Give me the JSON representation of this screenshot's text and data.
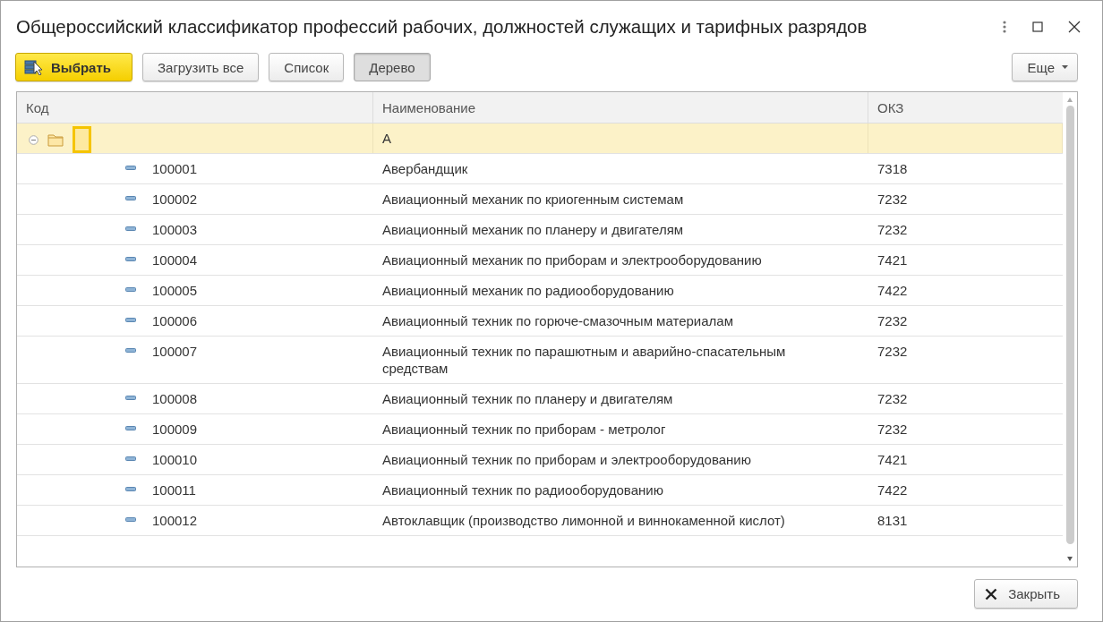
{
  "window": {
    "title": "Общероссийский классификатор профессий рабочих, должностей служащих и тарифных разрядов"
  },
  "toolbar": {
    "buttons": [
      {
        "label": "Выбрать",
        "kind": "primary"
      },
      {
        "label": "Загрузить все",
        "kind": "plain"
      },
      {
        "label": "Список",
        "kind": "toggle",
        "selected": false
      },
      {
        "label": "Дерево",
        "kind": "toggle",
        "selected": true
      }
    ],
    "more": "Еще"
  },
  "table": {
    "columns": [
      "Код",
      "Наименование",
      "ОКЗ"
    ],
    "rows": [
      {
        "kind": "group",
        "code": "",
        "name": "А",
        "okz": "",
        "expanded": true,
        "selected": true,
        "children": [
          {
            "kind": "item",
            "code": "100001",
            "name": "Авербандщик",
            "okz": "7318",
            "selected": false
          },
          {
            "kind": "item",
            "code": "100002",
            "name": "Авиационный механик по криогенным системам",
            "okz": "7232",
            "selected": false
          },
          {
            "kind": "item",
            "code": "100003",
            "name": "Авиационный механик по планеру и двигателям",
            "okz": "7232",
            "selected": false
          },
          {
            "kind": "item",
            "code": "100004",
            "name": "Авиационный механик по приборам и электрооборудованию",
            "okz": "7421",
            "selected": false
          },
          {
            "kind": "item",
            "code": "100005",
            "name": "Авиационный механик по радиооборудованию",
            "okz": "7422",
            "selected": false
          },
          {
            "kind": "item",
            "code": "100006",
            "name": "Авиационный техник по горюче-смазочным материалам",
            "okz": "7232",
            "selected": false
          },
          {
            "kind": "item",
            "code": "100007",
            "name": "Авиационный техник по парашютным и аварийно-спасательным средствам",
            "okz": "7232",
            "selected": false
          },
          {
            "kind": "item",
            "code": "100008",
            "name": "Авиационный техник по планеру и двигателям",
            "okz": "7232",
            "selected": false
          },
          {
            "kind": "item",
            "code": "100009",
            "name": "Авиационный техник по приборам - метролог",
            "okz": "7232",
            "selected": false
          },
          {
            "kind": "item",
            "code": "100010",
            "name": "Авиационный техник по приборам и электрооборудованию",
            "okz": "7421",
            "selected": false
          },
          {
            "kind": "item",
            "code": "100011",
            "name": "Авиационный техник по радиооборудованию",
            "okz": "7422",
            "selected": false
          },
          {
            "kind": "item",
            "code": "100012",
            "name": "Автоклавщик (производство лимонной и виннокаменной кислот)",
            "okz": "8131",
            "selected": false
          }
        ]
      }
    ]
  },
  "footer": {
    "close": "Закрыть"
  }
}
